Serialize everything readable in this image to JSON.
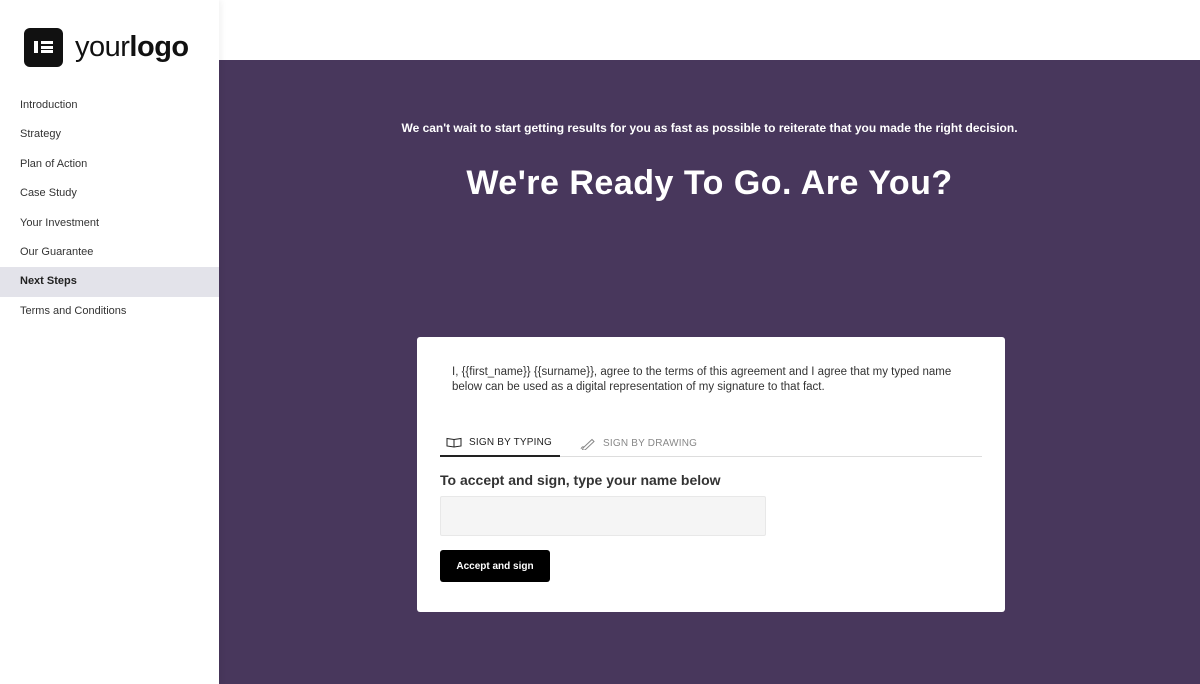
{
  "brand": {
    "logo_light": "your",
    "logo_bold": "logo"
  },
  "sidebar": {
    "items": [
      {
        "label": "Introduction",
        "active": false
      },
      {
        "label": "Strategy",
        "active": false
      },
      {
        "label": "Plan of Action",
        "active": false
      },
      {
        "label": "Case Study",
        "active": false
      },
      {
        "label": "Your Investment",
        "active": false
      },
      {
        "label": "Our Guarantee",
        "active": false
      },
      {
        "label": "Next Steps",
        "active": true
      },
      {
        "label": "Terms and Conditions",
        "active": false
      }
    ]
  },
  "hero": {
    "subtitle": "We can't wait to start getting results for you as fast as possible to reiterate that you made the right decision.",
    "headline": "We're Ready To Go. Are You?"
  },
  "signature": {
    "agreement_text": "I, {{first_name}} {{surname}}, agree to the terms of this agreement and I agree that my typed name below can be used as a digital representation of my signature to that fact.",
    "tabs": [
      {
        "label": "Sign by typing",
        "icon": "keyboard-icon",
        "active": true
      },
      {
        "label": "Sign by drawing",
        "icon": "pen-icon",
        "active": false
      }
    ],
    "prompt": "To accept and sign, type your name below",
    "input_value": "",
    "button_label": "Accept and sign"
  },
  "colors": {
    "main_bg": "#48375c",
    "active_nav_bg": "#e3e3ea",
    "button_bg": "#000000"
  }
}
